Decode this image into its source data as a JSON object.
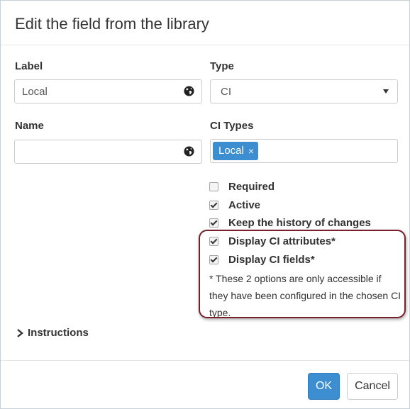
{
  "dialog": {
    "title": "Edit the field from the library"
  },
  "form": {
    "label_field": {
      "label": "Label",
      "value": "Local"
    },
    "type_field": {
      "label": "Type",
      "selected": "CI"
    },
    "name_field": {
      "label": "Name",
      "value": ""
    },
    "ci_types_field": {
      "label": "CI Types",
      "tags": [
        "Local"
      ],
      "remove_glyph": "×"
    }
  },
  "options": [
    {
      "label": "Required",
      "checked": false
    },
    {
      "label": "Active",
      "checked": true
    },
    {
      "label": "Keep the history of changes",
      "checked": true
    },
    {
      "label": "Display CI attributes*",
      "checked": true
    },
    {
      "label": "Display CI fields*",
      "checked": true
    }
  ],
  "note": "* These 2 options are only accessible if they have been configured in the chosen CI type.",
  "instructions": {
    "label": "Instructions"
  },
  "footer": {
    "ok_label": "OK",
    "cancel_label": "Cancel"
  },
  "colors": {
    "primary": "#3d8ed1",
    "highlight_border": "#7a1d2c"
  },
  "icons": {
    "globe": "globe-icon",
    "dropdown": "caret-down-icon",
    "expand": "chevron-right-icon"
  }
}
